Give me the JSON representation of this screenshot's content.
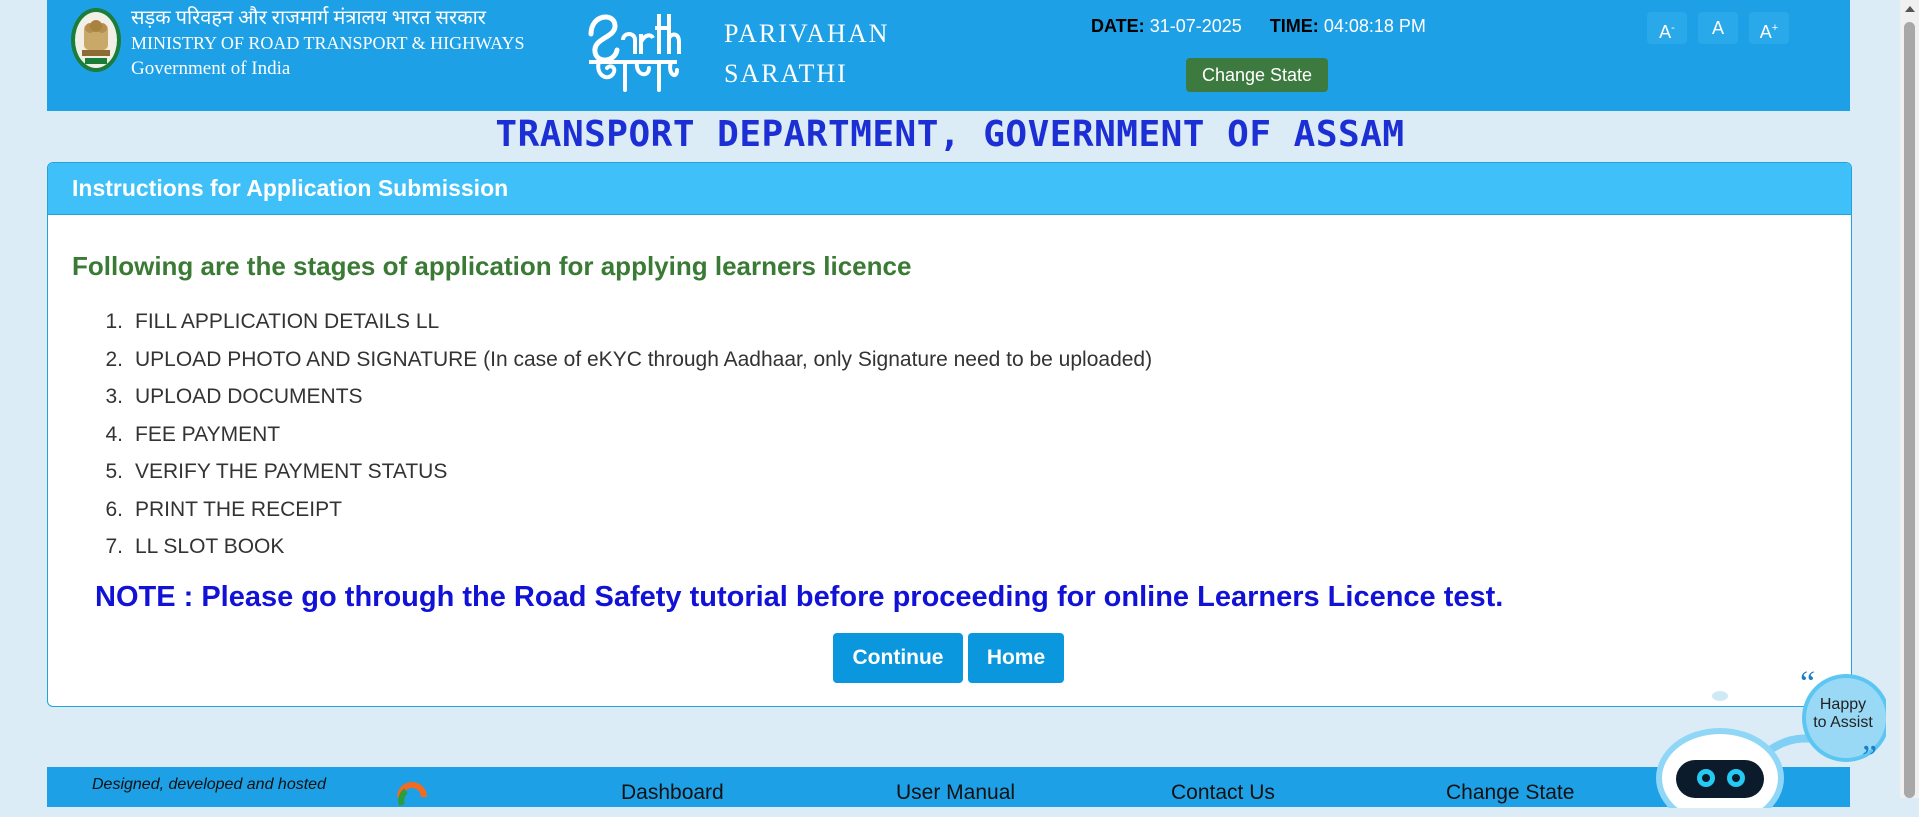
{
  "header": {
    "ministry_hindi": "सड़क परिवहन और राजमार्ग मंत्रालय भारत सरकार",
    "ministry_english": "MINISTRY OF ROAD TRANSPORT & HIGHWAYS",
    "government": "Government of India",
    "brand_line1": "PARIVAHAN",
    "brand_line2": "SARATHI",
    "date_label": "DATE:",
    "date_value": "31-07-2025",
    "time_label": "TIME:",
    "time_value": "04:08:18 PM",
    "change_state_label": "Change State",
    "font_small": "A",
    "font_small_sup": "-",
    "font_normal": "A",
    "font_large": "A",
    "font_large_sup": "+"
  },
  "page_title": "TRANSPORT DEPARTMENT, GOVERNMENT OF ASSAM",
  "panel": {
    "heading": "Instructions for Application Submission",
    "stages_heading": "Following are the stages of application for applying learners licence",
    "stages": [
      {
        "num": "1.",
        "text": "FILL APPLICATION DETAILS LL"
      },
      {
        "num": "2.",
        "text": "UPLOAD PHOTO AND SIGNATURE (In case of eKYC through Aadhaar, only Signature need to be uploaded)"
      },
      {
        "num": "3.",
        "text": "UPLOAD DOCUMENTS"
      },
      {
        "num": "4.",
        "text": "FEE PAYMENT"
      },
      {
        "num": "5.",
        "text": "VERIFY THE PAYMENT STATUS"
      },
      {
        "num": "6.",
        "text": "PRINT THE RECEIPT"
      },
      {
        "num": "7.",
        "text": "LL SLOT BOOK"
      }
    ],
    "note": "NOTE : Please go through the Road Safety tutorial before proceeding for online Learners Licence test.",
    "continue_label": "Continue",
    "home_label": "Home"
  },
  "footer": {
    "credit": "Designed, developed and hosted",
    "links": [
      "Dashboard",
      "User Manual",
      "Contact Us",
      "Change State"
    ]
  },
  "chatbot": {
    "line1": "Happy",
    "line2": "to Assist"
  },
  "colors": {
    "header_bg": "#1ea0e6",
    "page_title": "#1c2fd4",
    "panel_head": "#40c0f8",
    "stages_heading": "#3a7a34",
    "note": "#1112d6",
    "primary_button": "#0a97de",
    "change_state_button": "#3d7a3f"
  }
}
